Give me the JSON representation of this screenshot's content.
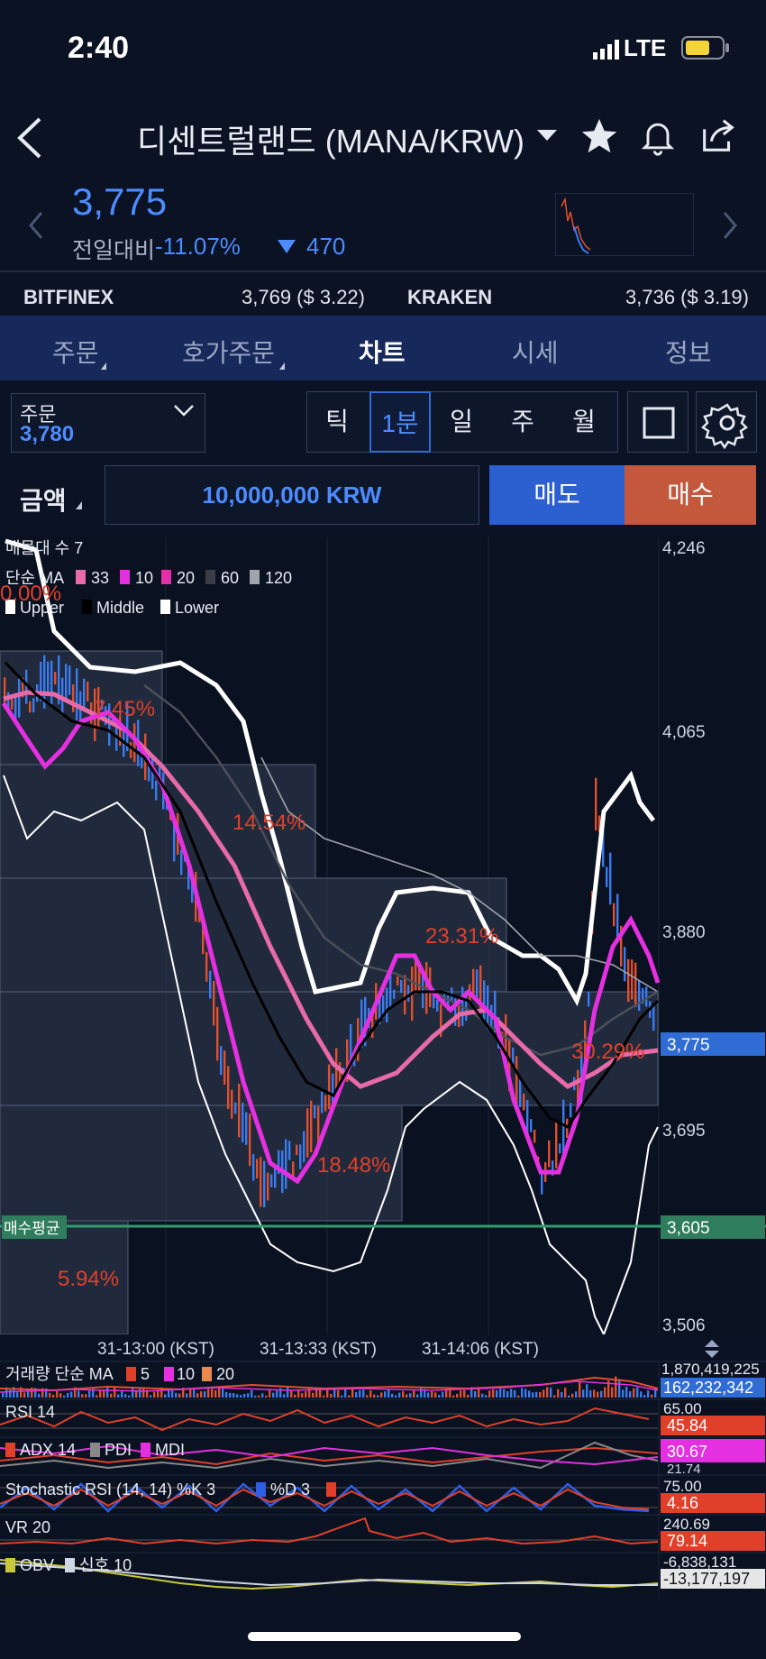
{
  "status": {
    "time": "2:40",
    "network": "LTE"
  },
  "header": {
    "title": "디센트럴랜드 (MANA/KRW)",
    "price": "3,775",
    "change_label": "전일대비",
    "change_pct": "-11.07%",
    "change_abs": "470"
  },
  "exchanges": [
    {
      "name": "BITFINEX",
      "value": "3,769 ($ 3.22)"
    },
    {
      "name": "KRAKEN",
      "value": "3,736 ($ 3.19)"
    }
  ],
  "tabs": [
    {
      "label": "주문",
      "has_menu": true
    },
    {
      "label": "호가주문",
      "has_menu": true
    },
    {
      "label": "차트",
      "active": true
    },
    {
      "label": "시세"
    },
    {
      "label": "정보"
    }
  ],
  "order": {
    "label": "주문",
    "value": "3,780"
  },
  "intervals": [
    "틱",
    "1분",
    "일",
    "주",
    "월"
  ],
  "active_interval": "1분",
  "amount": {
    "label": "금액",
    "value": "10,000,000 KRW"
  },
  "sell_label": "매도",
  "buy_label": "매수",
  "chart": {
    "top_label": "매물대 수 7",
    "ma_label": "단순 MA",
    "ma_periods": [
      "33",
      "10",
      "20",
      "60",
      "120"
    ],
    "bb": [
      "Upper",
      "Middle",
      "Lower"
    ],
    "pct_labels": [
      "0.00%",
      "7.45%",
      "14.54%",
      "23.31%",
      "30.29%",
      "18.48%",
      "5.94%"
    ],
    "avg_buy_label": "매수평균",
    "y_ticks": [
      "4,246",
      "4,065",
      "3,880",
      "3,775",
      "3,695",
      "3,605",
      "3,506"
    ],
    "x_ticks": [
      "31-13:00 (KST)",
      "31-13:33 (KST)",
      "31-14:06 (KST)"
    ],
    "volume": {
      "label": "거래량 단순 MA",
      "periods": [
        "5",
        "10",
        "20"
      ],
      "top": "1,870,419,225",
      "value": "162,232,342"
    },
    "rsi": {
      "label": "RSI 14",
      "top": "65.00",
      "value": "45.84"
    },
    "adx": {
      "label": "ADX 14",
      "pdi": "PDI",
      "mdi": "MDI",
      "value": "30.67",
      "below": "21.74"
    },
    "stoch": {
      "label": "Stochastic RSI (14, 14) %K 3",
      "d_label": "%D 3",
      "top": "75.00",
      "value": "4.16"
    },
    "vr": {
      "label": "VR 20",
      "top": "240.69",
      "value": "79.14"
    },
    "obv": {
      "label": "OBV",
      "signal": "신호 10",
      "top": "-6,838,131",
      "value": "-13,177,197"
    }
  },
  "colors": {
    "up": "#e0502f",
    "down": "#3a7bf0",
    "accent": "#4d8cff",
    "tabbar": "#16295a"
  }
}
